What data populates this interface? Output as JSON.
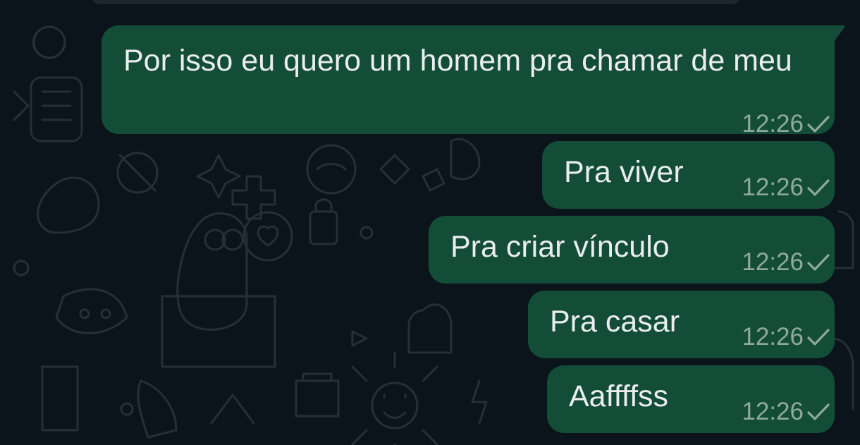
{
  "chat": {
    "messages": [
      {
        "text": "Por isso eu quero um homem pra chamar de meu",
        "time": "12:26",
        "status": "sent-check-icon"
      },
      {
        "text": "Pra viver",
        "time": "12:26",
        "status": "sent-check-icon"
      },
      {
        "text": "Pra criar vínculo",
        "time": "12:26",
        "status": "sent-check-icon"
      },
      {
        "text": "Pra casar",
        "time": "12:26",
        "status": "sent-check-icon"
      },
      {
        "text": "Aaffffss",
        "time": "12:26",
        "status": "sent-check-icon"
      }
    ]
  },
  "theme": {
    "background": "#0b141a",
    "outgoing_bubble": "#134d37",
    "text": "#e9edef",
    "meta": "#8fa9a0"
  }
}
